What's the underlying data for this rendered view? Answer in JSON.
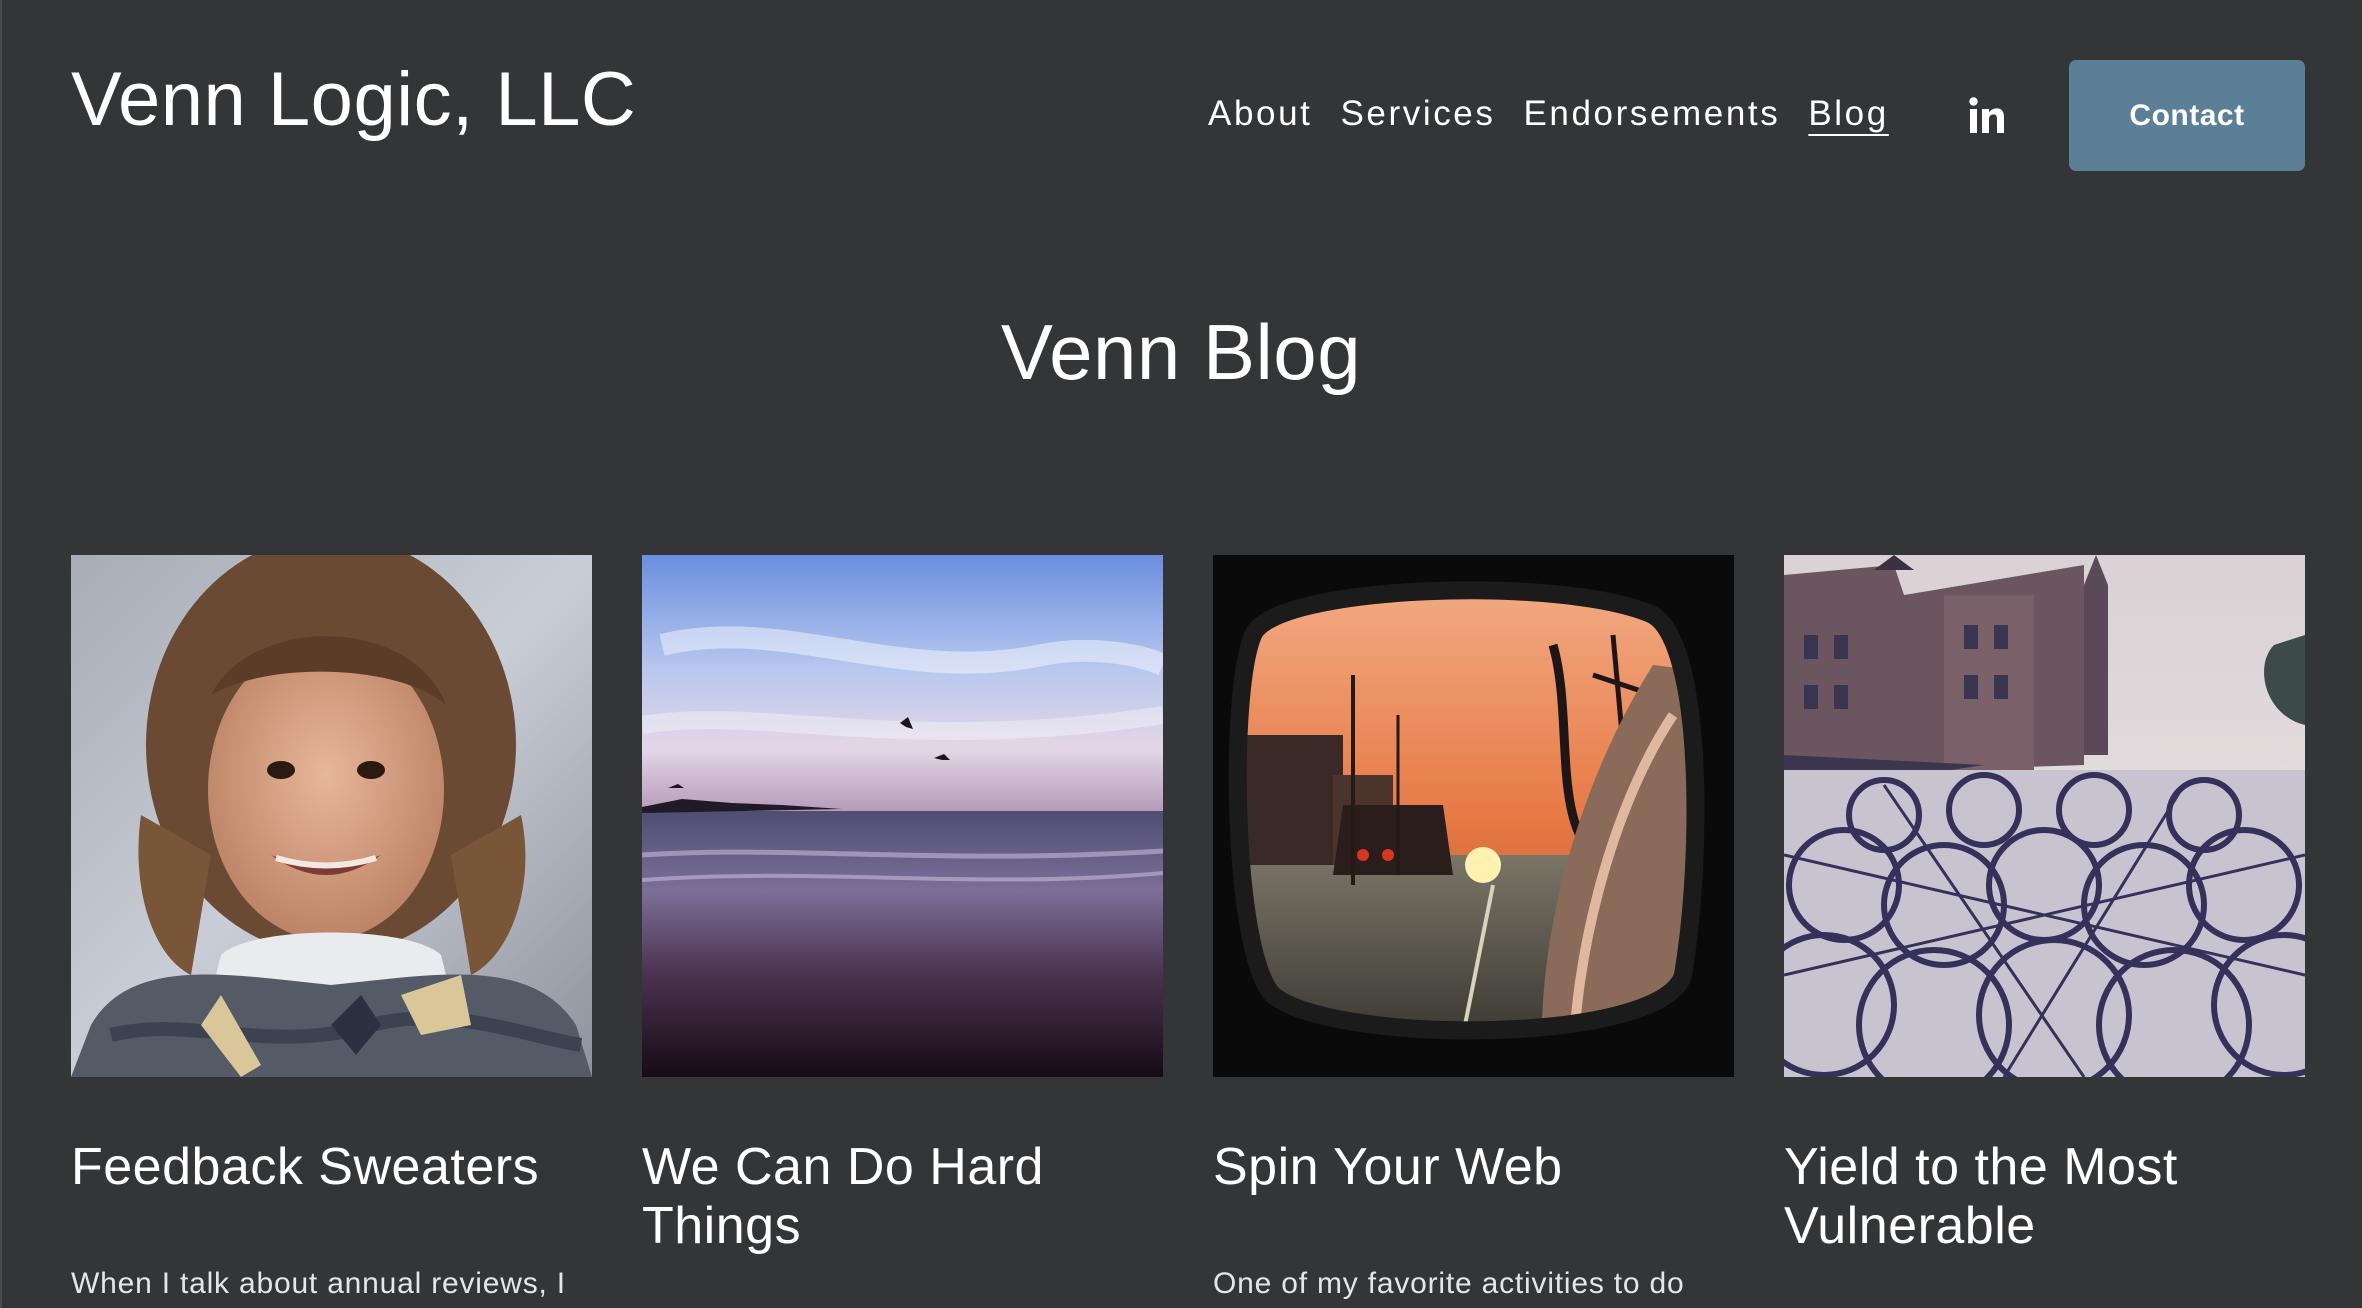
{
  "header": {
    "site_title": "Venn Logic, LLC",
    "nav": [
      {
        "label": "About"
      },
      {
        "label": "Services"
      },
      {
        "label": "Endorsements"
      },
      {
        "label": "Blog",
        "active": true
      }
    ],
    "social_icon": "linkedin-icon",
    "contact_label": "Contact"
  },
  "page": {
    "title": "Venn Blog"
  },
  "posts": [
    {
      "title": "Feedback Sweaters",
      "excerpt": "When I talk about annual reviews, I",
      "image": "child-portrait-photo"
    },
    {
      "title": "We Can Do Hard Things",
      "excerpt": "",
      "image": "beach-sunset-photo"
    },
    {
      "title": "Spin Your Web",
      "excerpt": "One of my favorite activities to do",
      "image": "side-mirror-sunset-photo"
    },
    {
      "title": "Yield to the Most Vulnerable",
      "excerpt": "",
      "image": "bicycle-parking-photo"
    }
  ],
  "colors": {
    "background": "#343537",
    "accent": "#5a7f97",
    "text": "#ffffff"
  }
}
